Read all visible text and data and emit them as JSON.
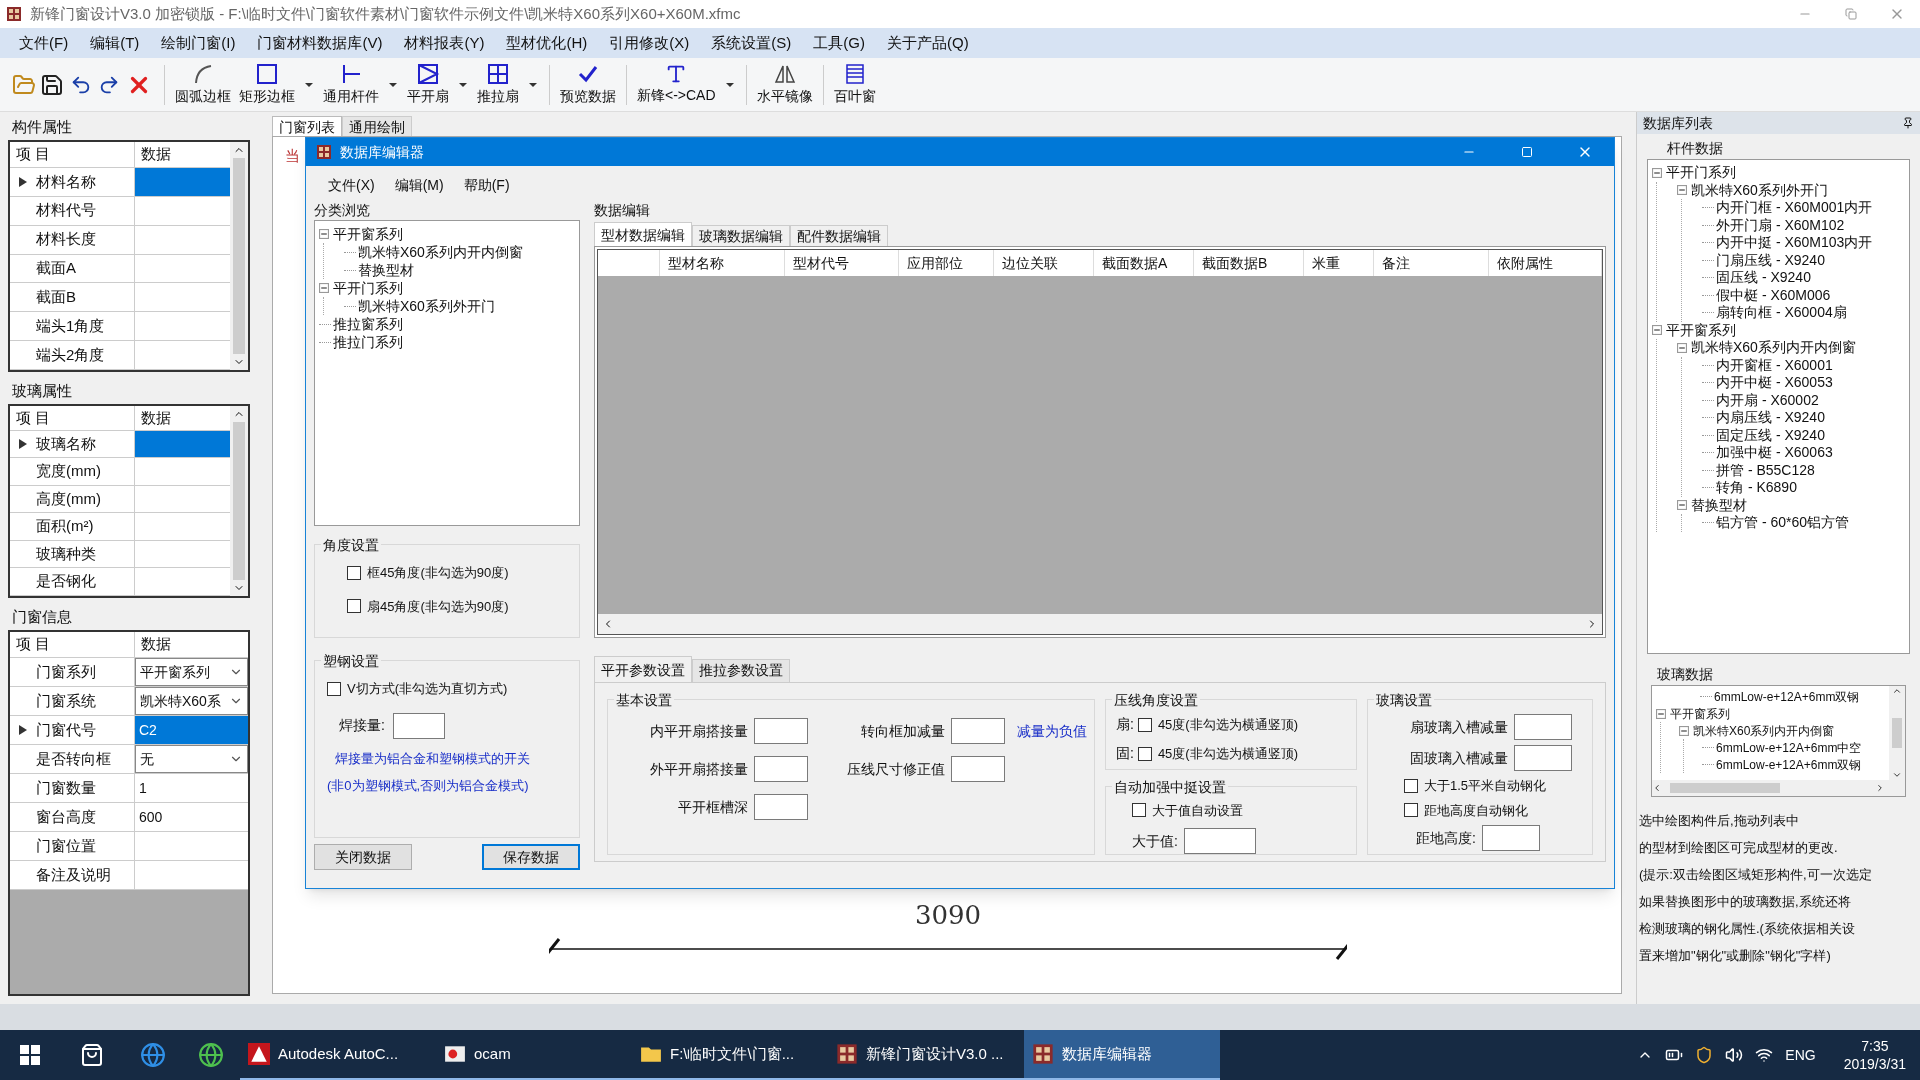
{
  "window": {
    "title": "新锋门窗设计V3.0 加密锁版 - F:\\临时文件\\门窗软件素材\\门窗软件示例文件\\凯米特X60系列X60+X60M.xfmc"
  },
  "menu": [
    "文件(F)",
    "编辑(T)",
    "绘制门窗(I)",
    "门窗材料数据库(V)",
    "材料报表(Y)",
    "型材优化(H)",
    "引用修改(X)",
    "系统设置(S)",
    "工具(G)",
    "关于产品(Q)"
  ],
  "toolbar": [
    {
      "label": "圆弧边框",
      "dropdown": false
    },
    {
      "label": "矩形边框",
      "dropdown": true
    },
    {
      "label": "通用杆件",
      "dropdown": true
    },
    {
      "label": "平开扇",
      "dropdown": true
    },
    {
      "label": "推拉扇",
      "dropdown": true
    },
    {
      "label": "预览数据",
      "dropdown": false
    },
    {
      "label": "新锋<->CAD",
      "dropdown": true
    },
    {
      "label": "水平镜像",
      "dropdown": false
    },
    {
      "label": "百叶窗",
      "dropdown": false
    }
  ],
  "left_panel": {
    "sections": [
      {
        "title": "构件属性",
        "columns": [
          "项 目",
          "数据"
        ],
        "rows": [
          {
            "label": "材料名称",
            "selected": true
          },
          {
            "label": "材料代号",
            "selected": false
          },
          {
            "label": "材料长度",
            "selected": false
          },
          {
            "label": "截面A",
            "selected": false
          },
          {
            "label": "截面B",
            "selected": false
          },
          {
            "label": "端头1角度",
            "selected": false
          },
          {
            "label": "端头2角度",
            "selected": false
          }
        ]
      },
      {
        "title": "玻璃属性",
        "columns": [
          "项 目",
          "数据"
        ],
        "rows": [
          {
            "label": "玻璃名称",
            "selected": true
          },
          {
            "label": "宽度(mm)",
            "selected": false
          },
          {
            "label": "高度(mm)",
            "selected": false
          },
          {
            "label": "面积(m²)",
            "selected": false
          },
          {
            "label": "玻璃种类",
            "selected": false
          },
          {
            "label": "是否钢化",
            "selected": false
          }
        ]
      },
      {
        "title": "门窗信息",
        "columns": [
          "项 目",
          "数据"
        ],
        "rows": [
          {
            "label": "门窗系列",
            "value": "平开窗系列",
            "kind": "dropdown",
            "selected": false
          },
          {
            "label": "门窗系统",
            "value": "凯米特X60系",
            "kind": "dropdown",
            "selected": false
          },
          {
            "label": "门窗代号",
            "value": "C2",
            "kind": "text",
            "selected": true
          },
          {
            "label": "是否转向框",
            "value": "无",
            "kind": "dropdown",
            "selected": false
          },
          {
            "label": "门窗数量",
            "value": "1",
            "kind": "text",
            "selected": false
          },
          {
            "label": "窗台高度",
            "value": "600",
            "kind": "text",
            "selected": false
          },
          {
            "label": "门窗位置",
            "kind": "text",
            "selected": false
          },
          {
            "label": "备注及说明",
            "kind": "text",
            "selected": false
          }
        ]
      }
    ]
  },
  "canvas": {
    "tabs": [
      {
        "label": "门窗列表",
        "selected": true
      },
      {
        "label": "通用绘制",
        "selected": false
      }
    ],
    "note": "当",
    "dimension": "3090"
  },
  "dialog": {
    "title": "数据库编辑器",
    "menu": [
      "文件(X)",
      "编辑(M)",
      "帮助(F)"
    ],
    "browse": {
      "title": "分类浏览",
      "nodes": [
        {
          "label": "平开窗系列",
          "expanded": true,
          "children": [
            {
              "label": "凯米特X60系列内开内倒窗"
            },
            {
              "label": "替换型材"
            }
          ]
        },
        {
          "label": "平开门系列",
          "expanded": true,
          "children": [
            {
              "label": "凯米特X60系列外开门"
            }
          ]
        },
        {
          "label": "推拉窗系列"
        },
        {
          "label": "推拉门系列"
        }
      ]
    },
    "angle": {
      "title": "角度设置",
      "options": [
        {
          "label": "框45角度(非勾选为90度)",
          "checked": false
        },
        {
          "label": "扇45角度(非勾选为90度)",
          "checked": false
        }
      ]
    },
    "plastic": {
      "title": "塑钢设置",
      "option": {
        "label": "V切方式(非勾选为直切方式)",
        "checked": false
      },
      "weld_label": "焊接量:",
      "note": [
        "焊接量为铝合金和塑钢模式的开关",
        "(非0为塑钢模式,否则为铝合金模式)"
      ]
    },
    "buttons": [
      {
        "label": "关闭数据",
        "default": false
      },
      {
        "label": "保存数据",
        "default": true
      }
    ],
    "editor": {
      "title": "数据编辑",
      "tabs": [
        {
          "label": "型材数据编辑",
          "selected": true
        },
        {
          "label": "玻璃数据编辑",
          "selected": false
        },
        {
          "label": "配件数据编辑",
          "selected": false
        }
      ],
      "columns": [
        "型材名称",
        "型材代号",
        "应用部位",
        "边位关联",
        "截面数据A",
        "截面数据B",
        "米重",
        "备注",
        "依附属性"
      ]
    },
    "param_tabs": [
      {
        "label": "平开参数设置",
        "selected": true
      },
      {
        "label": "推拉参数设置",
        "selected": false
      }
    ],
    "basic": {
      "title": "基本设置",
      "fields": [
        "内平开扇搭接量",
        "转向框加减量",
        "外平开扇搭接量",
        "压线尺寸修正值",
        "平开框槽深"
      ],
      "hint": "减量为负值"
    },
    "bead_angle": {
      "title": "压线角度设置",
      "options": [
        {
          "prefix": "扇:",
          "label": "45度(非勾选为横通竖顶)",
          "checked": false
        },
        {
          "prefix": "固:",
          "label": "45度(非勾选为横通竖顶)",
          "checked": false
        }
      ]
    },
    "mullion": {
      "title": "自动加强中挺设置",
      "option": {
        "label": "大于值自动设置",
        "checked": false
      },
      "field": "大于值:"
    },
    "glass": {
      "title": "玻璃设置",
      "fields": [
        "扇玻璃入槽减量",
        "固玻璃入槽减量"
      ],
      "options": [
        {
          "label": "大于1.5平米自动钢化",
          "checked": false
        },
        {
          "label": "距地高度自动钢化",
          "checked": false
        }
      ],
      "field": "距地高度:"
    }
  },
  "right_panel": {
    "title": "数据库列表",
    "bars": {
      "title": "杆件数据",
      "nodes": [
        {
          "label": "平开门系列",
          "expanded": true,
          "children": [
            {
              "label": "凯米特X60系列外开门",
              "expanded": true,
              "children": [
                {
                  "label": "内开门框 - X60M001内开"
                },
                {
                  "label": "外开门扇 - X60M102"
                },
                {
                  "label": "内开中挺 - X60M103内开"
                },
                {
                  "label": "门扇压线 - X9240"
                },
                {
                  "label": "固压线 - X9240"
                },
                {
                  "label": "假中梃 - X60M006"
                },
                {
                  "label": "扇转向框 - X60004扇"
                }
              ]
            }
          ]
        },
        {
          "label": "平开窗系列",
          "expanded": true,
          "children": [
            {
              "label": "凯米特X60系列内开内倒窗",
              "expanded": true,
              "children": [
                {
                  "label": "内开窗框 - X60001"
                },
                {
                  "label": "内开中梃 - X60053"
                },
                {
                  "label": "内开扇 - X60002"
                },
                {
                  "label": "内扇压线 - X9240"
                },
                {
                  "label": "固定压线 - X9240"
                },
                {
                  "label": "加强中梃 - X60063"
                },
                {
                  "label": "拼管 - B55C128"
                },
                {
                  "label": "转角 - K6890"
                }
              ]
            },
            {
              "label": "替换型材",
              "expanded": true,
              "children": [
                {
                  "label": "铝方管 - 60*60铝方管"
                }
              ]
            }
          ]
        }
      ]
    },
    "glass": {
      "title": "玻璃数据",
      "nodes": [
        {
          "label": "6mmLow-e+12A+6mm双钢",
          "kind": "continued"
        },
        {
          "label": "平开窗系列",
          "expanded": true,
          "children": [
            {
              "label": "凯米特X60系列内开内倒窗",
              "expanded": true,
              "children": [
                {
                  "label": "6mmLow-e+12A+6mm中空"
                },
                {
                  "label": "6mmLow-e+12A+6mm双钢"
                }
              ]
            }
          ]
        }
      ]
    },
    "help": [
      "选中绘图构件后,拖动列表中",
      "的型材到绘图区可完成型材的更改.",
      "(提示:双击绘图区域矩形构件,可一次选定",
      "如果替换图形中的玻璃数据,系统还将",
      "检测玻璃的钢化属性.(系统依据相关设",
      "置来增加\"钢化\"或删除\"钢化\"字样)"
    ]
  },
  "taskbar": {
    "apps": [
      {
        "label": "Autodesk AutoC...",
        "selected": false
      },
      {
        "label": "ocam",
        "selected": false
      },
      {
        "label": "F:\\临时文件\\门窗...",
        "selected": false
      },
      {
        "label": "新锋门窗设计V3.0 ...",
        "selected": false
      },
      {
        "label": "数据库编辑器",
        "selected": true
      }
    ],
    "language": "ENG",
    "time": "7:35",
    "date": "2019/3/31"
  }
}
